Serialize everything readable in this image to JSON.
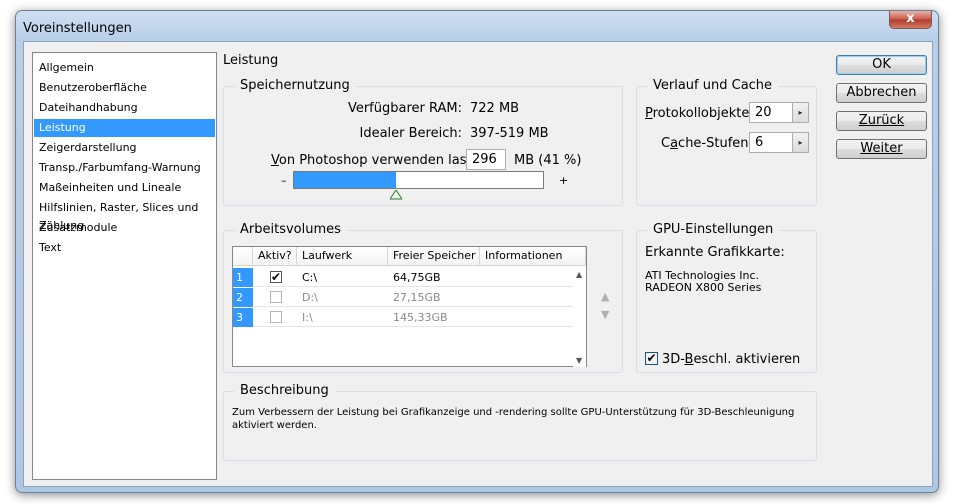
{
  "window": {
    "title": "Voreinstellungen",
    "close_glyph": "x"
  },
  "sidebar": {
    "items": [
      {
        "label": "Allgemein",
        "selected": false
      },
      {
        "label": "Benutzeroberfläche",
        "selected": false
      },
      {
        "label": "Dateihandhabung",
        "selected": false
      },
      {
        "label": "Leistung",
        "selected": true
      },
      {
        "label": "Zeigerdarstellung",
        "selected": false
      },
      {
        "label": "Transp./Farbumfang-Warnung",
        "selected": false
      },
      {
        "label": "Maßeinheiten und Lineale",
        "selected": false
      },
      {
        "label": "Hilfslinien, Raster, Slices und Zählung",
        "selected": false
      },
      {
        "label": "Zusatzmodule",
        "selected": false
      },
      {
        "label": "Text",
        "selected": false
      }
    ]
  },
  "section_title": "Leistung",
  "memory": {
    "group_title": "Speichernutzung",
    "available_label": "Verfügbarer RAM:",
    "available_value": "722 MB",
    "ideal_label": "Idealer Bereich:",
    "ideal_value": "397-519 MB",
    "use_label_u": "V",
    "use_label_rest": "on Photoshop verwenden lassen:",
    "use_value": "296",
    "use_unit": "MB (41 %)",
    "slider_fraction": 0.41,
    "minus": "–",
    "plus": "+"
  },
  "history": {
    "group_title": "Verlauf und Cache",
    "states_label_u": "P",
    "states_label_rest": "rotokollobjekte:",
    "states_value": "20",
    "cache_label_pre": "C",
    "cache_label_u": "a",
    "cache_label_rest": "che-Stufen:",
    "cache_value": "6"
  },
  "scratch": {
    "group_title": "Arbeitsvolumes",
    "headers": [
      "Aktiv?",
      "Laufwerk",
      "Freier Speicher",
      "Informationen"
    ],
    "rows": [
      {
        "num": "1",
        "active": true,
        "drive": "C:\\",
        "free": "64,75GB",
        "info": ""
      },
      {
        "num": "2",
        "active": false,
        "drive": "D:\\",
        "free": "27,15GB",
        "info": ""
      },
      {
        "num": "3",
        "active": false,
        "drive": "I:\\",
        "free": "145,33GB",
        "info": ""
      }
    ],
    "up_glyph": "▲",
    "down_glyph": "▼"
  },
  "gpu": {
    "group_title": "GPU-Einstellungen",
    "detected_label": "Erkannte Grafikkarte:",
    "card_line1": "ATI Technologies Inc.",
    "card_line2": "RADEON X800 Series",
    "enable_checked": true,
    "enable_label_pre": "3D-",
    "enable_label_u": "B",
    "enable_label_rest": "eschl. aktivieren"
  },
  "description": {
    "group_title": "Beschreibung",
    "text": "Zum Verbessern der Leistung bei Grafikanzeige und -rendering sollte GPU-Unterstützung für 3D-Beschleunigung aktiviert werden."
  },
  "buttons": {
    "ok": "OK",
    "cancel": "Abbrechen",
    "back": "Zurück",
    "next": "Weiter"
  },
  "check_glyph": "✔"
}
